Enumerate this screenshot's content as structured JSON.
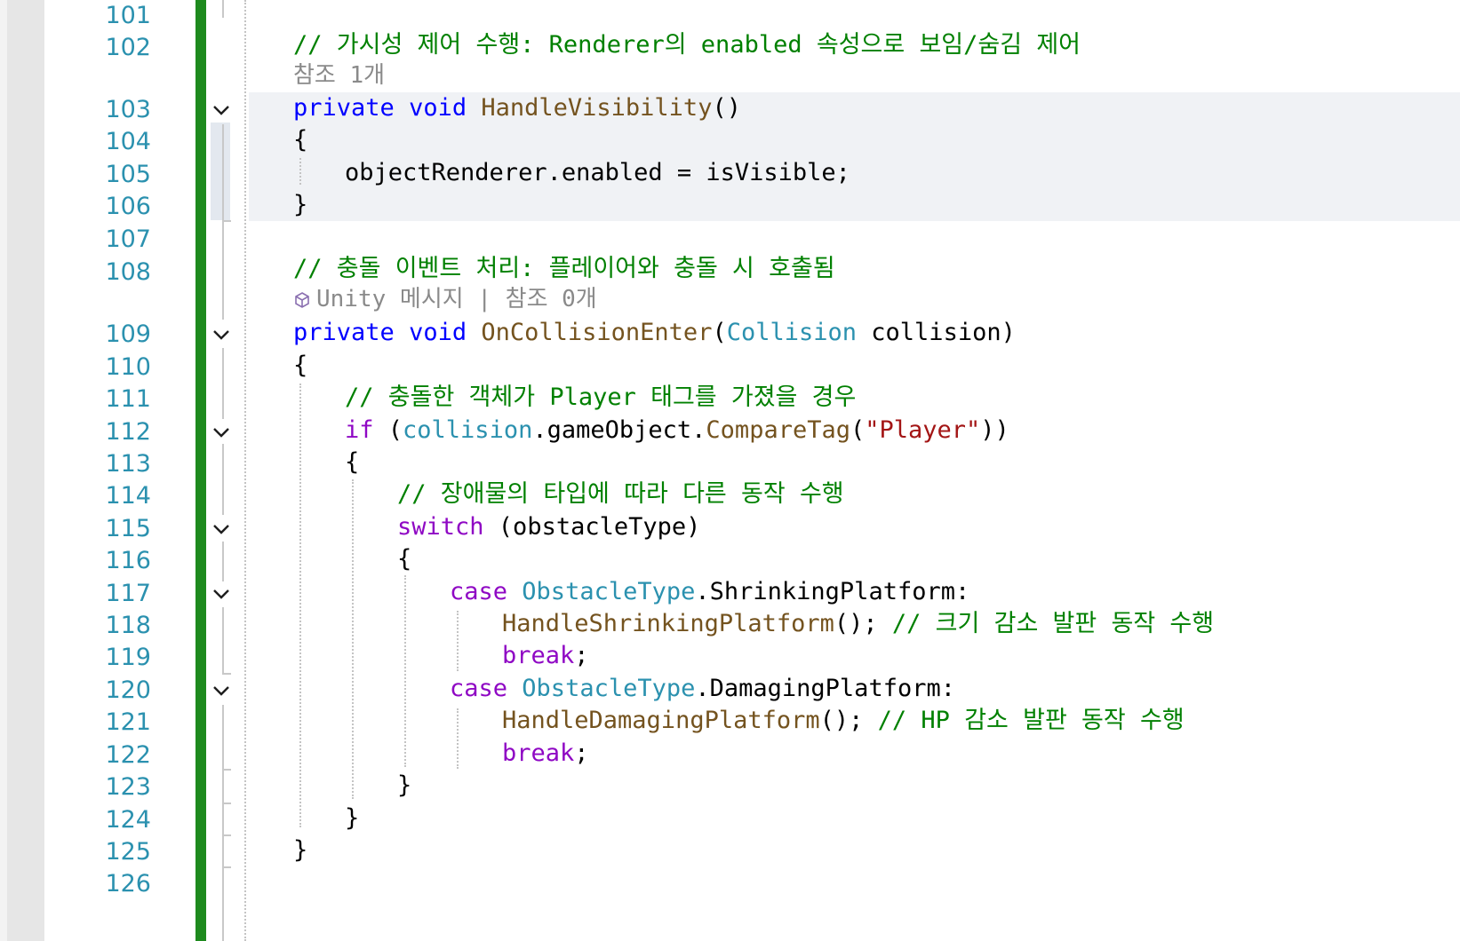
{
  "editor": {
    "lines": [
      {
        "num": "101"
      },
      {
        "num": "102",
        "comment": "// 가시성 제어 수행: Renderer의 enabled 속성으로 보임/숨김 제어",
        "hint": "참조 1개"
      },
      {
        "num": "103",
        "p1": "private",
        "p2": "void",
        "p3": "HandleVisibility",
        "p4": "()"
      },
      {
        "num": "104",
        "text": "{"
      },
      {
        "num": "105",
        "text": "objectRenderer.enabled = isVisible;"
      },
      {
        "num": "106",
        "text": "}"
      },
      {
        "num": "107"
      },
      {
        "num": "108",
        "comment": "// 충돌 이벤트 처리: 플레이어와 충돌 시 호출됨",
        "hint_unity": "Unity 메시지",
        "hint_sep": " | ",
        "hint_ref": "참조 0개"
      },
      {
        "num": "109",
        "p1": "private",
        "p2": "void",
        "p3": "OnCollisionEnter",
        "p4": "(",
        "p5": "Collision",
        "p6": " collision)"
      },
      {
        "num": "110",
        "text": "{"
      },
      {
        "num": "111",
        "comment": "// 충돌한 객체가 Player 태그를 가졌을 경우"
      },
      {
        "num": "112",
        "p1": "if",
        "p2": " (",
        "p3": "collision",
        "p4": ".gameObject.",
        "p5": "CompareTag",
        "p6": "(",
        "p7": "\"Player\"",
        "p8": "))"
      },
      {
        "num": "113",
        "text": "{"
      },
      {
        "num": "114",
        "comment": "// 장애물의 타입에 따라 다른 동작 수행"
      },
      {
        "num": "115",
        "p1": "switch",
        "p2": " (obstacleType)"
      },
      {
        "num": "116",
        "text": "{"
      },
      {
        "num": "117",
        "p1": "case",
        "p2": " ",
        "p3": "ObstacleType",
        "p4": ".ShrinkingPlatform:"
      },
      {
        "num": "118",
        "p1": "HandleShrinkingPlatform",
        "p2": "(); ",
        "p3": "// 크기 감소 발판 동작 수행"
      },
      {
        "num": "119",
        "p1": "break",
        "p2": ";"
      },
      {
        "num": "120",
        "p1": "case",
        "p2": " ",
        "p3": "ObstacleType",
        "p4": ".DamagingPlatform:"
      },
      {
        "num": "121",
        "p1": "HandleDamagingPlatform",
        "p2": "(); ",
        "p3": "// HP 감소 발판 동작 수행"
      },
      {
        "num": "122",
        "p1": "break",
        "p2": ";"
      },
      {
        "num": "123",
        "text": "}"
      },
      {
        "num": "124",
        "text": "}"
      },
      {
        "num": "125",
        "text": "}"
      },
      {
        "num": "126"
      }
    ]
  },
  "colors": {
    "change_bar": "#1e8a1e",
    "keyword": "#0000ff",
    "control_keyword": "#8f08c4",
    "type": "#2b91af",
    "method": "#74531f",
    "string": "#a31515",
    "comment": "#008000"
  },
  "icons": [
    "chevron-down-icon",
    "unity-cube-icon"
  ]
}
